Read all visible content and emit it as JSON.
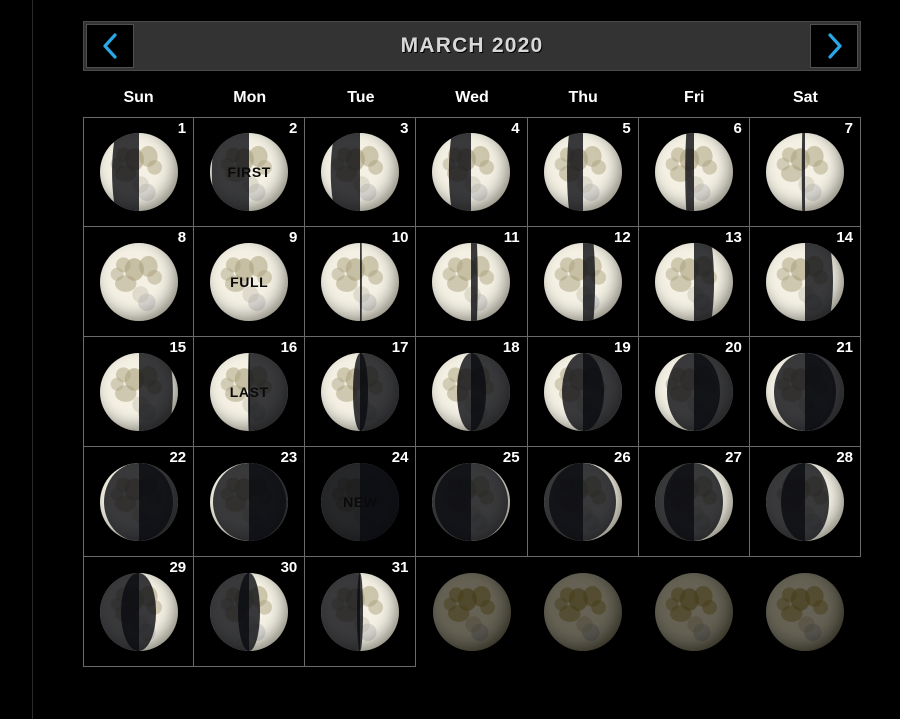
{
  "page": {
    "background_color": "#000000"
  },
  "header": {
    "title": "MARCH 2020",
    "prev_label": "‹",
    "next_label": "›",
    "prev_icon": "chevron-left-icon",
    "next_icon": "chevron-right-icon",
    "bar_color": "#333333",
    "accent_color": "#29a7e6",
    "title_color": "#d8d8d8"
  },
  "weekdays": [
    {
      "label": "Sun"
    },
    {
      "label": "Mon"
    },
    {
      "label": "Tue"
    },
    {
      "label": "Wed"
    },
    {
      "label": "Thu"
    },
    {
      "label": "Fri"
    },
    {
      "label": "Sat"
    }
  ],
  "calendar": {
    "month": "MARCH",
    "year": "2020",
    "cells": [
      {
        "date": "1",
        "phase": "waxing-gibbous",
        "illum": 0.66,
        "lit": "right",
        "label": ""
      },
      {
        "date": "2",
        "phase": "first-quarter",
        "illum": 0.52,
        "lit": "right",
        "label": "FIRST"
      },
      {
        "date": "3",
        "phase": "waxing-gibbous",
        "illum": 0.62,
        "lit": "right",
        "label": ""
      },
      {
        "date": "4",
        "phase": "waxing-gibbous",
        "illum": 0.71,
        "lit": "right",
        "label": ""
      },
      {
        "date": "5",
        "phase": "waxing-gibbous",
        "illum": 0.8,
        "lit": "right",
        "label": ""
      },
      {
        "date": "6",
        "phase": "waxing-gibbous",
        "illum": 0.89,
        "lit": "right",
        "label": ""
      },
      {
        "date": "7",
        "phase": "waxing-gibbous",
        "illum": 0.96,
        "lit": "right",
        "label": ""
      },
      {
        "date": "8",
        "phase": "full",
        "illum": 1.0,
        "lit": "right",
        "label": ""
      },
      {
        "date": "9",
        "phase": "full",
        "illum": 1.0,
        "lit": "right",
        "label": "FULL"
      },
      {
        "date": "10",
        "phase": "waning-gibbous",
        "illum": 0.98,
        "lit": "left",
        "label": ""
      },
      {
        "date": "11",
        "phase": "waning-gibbous",
        "illum": 0.92,
        "lit": "left",
        "label": ""
      },
      {
        "date": "12",
        "phase": "waning-gibbous",
        "illum": 0.84,
        "lit": "left",
        "label": ""
      },
      {
        "date": "13",
        "phase": "waning-gibbous",
        "illum": 0.74,
        "lit": "left",
        "label": ""
      },
      {
        "date": "14",
        "phase": "waning-gibbous",
        "illum": 0.64,
        "lit": "left",
        "label": ""
      },
      {
        "date": "15",
        "phase": "waning-gibbous",
        "illum": 0.56,
        "lit": "left",
        "label": ""
      },
      {
        "date": "16",
        "phase": "last-quarter",
        "illum": 0.49,
        "lit": "left",
        "label": "LAST"
      },
      {
        "date": "17",
        "phase": "waning-crescent",
        "illum": 0.4,
        "lit": "left",
        "label": ""
      },
      {
        "date": "18",
        "phase": "waning-crescent",
        "illum": 0.31,
        "lit": "left",
        "label": ""
      },
      {
        "date": "19",
        "phase": "waning-crescent",
        "illum": 0.23,
        "lit": "left",
        "label": ""
      },
      {
        "date": "20",
        "phase": "waning-crescent",
        "illum": 0.16,
        "lit": "left",
        "label": ""
      },
      {
        "date": "21",
        "phase": "waning-crescent",
        "illum": 0.1,
        "lit": "left",
        "label": ""
      },
      {
        "date": "22",
        "phase": "waning-crescent",
        "illum": 0.06,
        "lit": "left",
        "label": ""
      },
      {
        "date": "23",
        "phase": "waning-crescent",
        "illum": 0.03,
        "lit": "left",
        "label": ""
      },
      {
        "date": "24",
        "phase": "new",
        "illum": 0.0,
        "lit": "left",
        "label": "NEW"
      },
      {
        "date": "25",
        "phase": "waxing-crescent",
        "illum": 0.03,
        "lit": "right",
        "label": ""
      },
      {
        "date": "26",
        "phase": "waxing-crescent",
        "illum": 0.07,
        "lit": "right",
        "label": ""
      },
      {
        "date": "27",
        "phase": "waxing-crescent",
        "illum": 0.12,
        "lit": "right",
        "label": ""
      },
      {
        "date": "28",
        "phase": "waxing-crescent",
        "illum": 0.19,
        "lit": "right",
        "label": ""
      },
      {
        "date": "29",
        "phase": "waxing-crescent",
        "illum": 0.27,
        "lit": "right",
        "label": ""
      },
      {
        "date": "30",
        "phase": "waxing-crescent",
        "illum": 0.36,
        "lit": "right",
        "label": ""
      },
      {
        "date": "31",
        "phase": "waxing-crescent",
        "illum": 0.46,
        "lit": "right",
        "label": ""
      },
      {
        "date": "",
        "phase": "placeholder",
        "illum": 1.0,
        "lit": "right",
        "label": ""
      },
      {
        "date": "",
        "phase": "placeholder",
        "illum": 1.0,
        "lit": "right",
        "label": ""
      },
      {
        "date": "",
        "phase": "placeholder",
        "illum": 1.0,
        "lit": "right",
        "label": ""
      },
      {
        "date": "",
        "phase": "placeholder",
        "illum": 1.0,
        "lit": "right",
        "label": ""
      }
    ]
  }
}
